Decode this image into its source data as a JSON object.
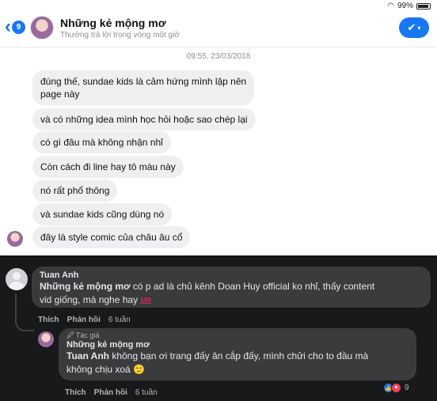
{
  "status_bar": {
    "wifi_icon": "wifi-icon",
    "battery": "99%"
  },
  "header": {
    "back_count": "9",
    "title": "Những kẻ mộng mơ",
    "subtitle": "Thường trả lời trong vòng một giờ",
    "check_icon": "✔"
  },
  "timestamp": "09:55, 23/03/2018",
  "messages": [
    "đúng thế, sundae kids là cảm hứng mình lập nên",
    "page này",
    "và có những idea mình học hỏi hoặc sao chép lại",
    "có gì đâu mà không nhận nhỉ",
    "Còn cách đi line hay tô màu này",
    "nó rất phổ thông",
    "và sundae kids cũng dùng nó",
    "đây là style comic của châu âu cổ"
  ],
  "comment1": {
    "name": "Tuan Anh",
    "mention": "Những kẻ mộng mơ",
    "text_line1": " có p ad là chủ kênh Doan Huy official ko nhỉ, thấy content",
    "text_line2": "vid giống, mà nghe hay ",
    "emoji": "100",
    "like": "Thích",
    "reply": "Phản hồi",
    "time": "6 tuần"
  },
  "comment2": {
    "author_tag": "🖉 Tác giả",
    "name": "Những kẻ mộng mơ",
    "mention": "Tuan Anh",
    "text_line1": " không bạn ơi trang đấy ăn cắp đấy, mình chửi cho to đầu mà",
    "text_line2": "không chịu xoá 🙂",
    "like": "Thích",
    "reply": "Phản hồi",
    "time": "6 tuần",
    "reaction_count": "9"
  }
}
